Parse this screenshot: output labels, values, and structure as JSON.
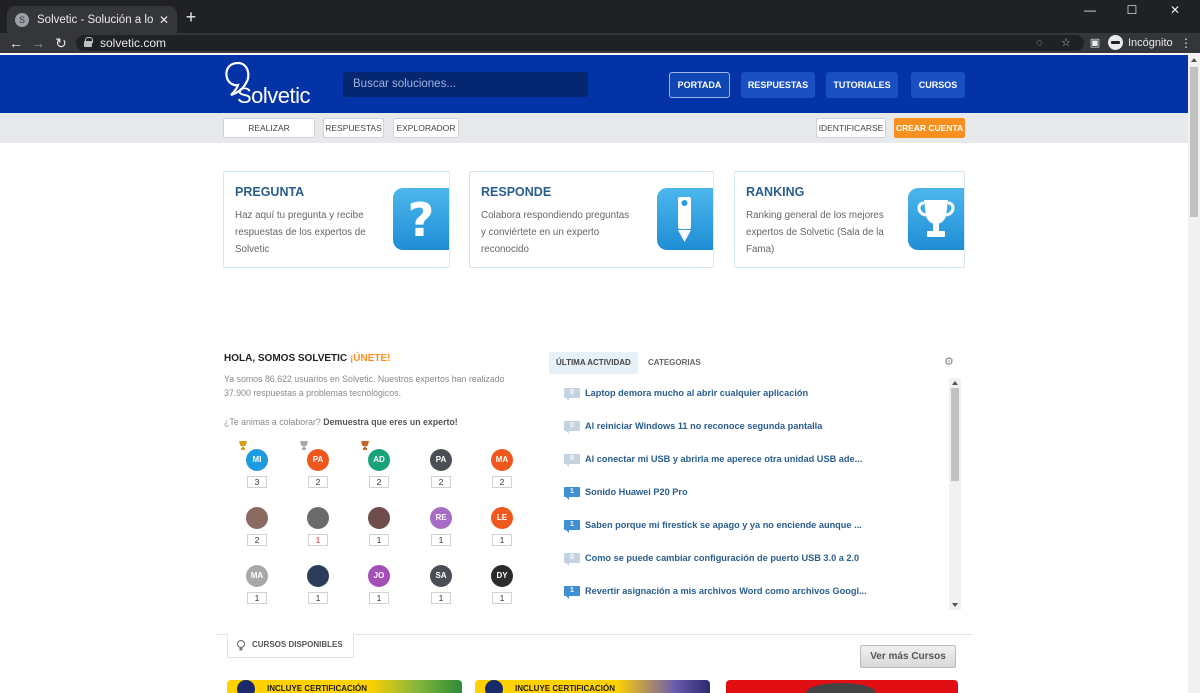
{
  "browser": {
    "tab_title": "Solvetic - Solución a los problem",
    "url": "solvetic.com",
    "profile": "Incógnito",
    "newtab_glyph": "+",
    "close_glyph": "✕",
    "min_glyph": "—",
    "max_glyph": "☐",
    "winclose_glyph": "✕",
    "back_glyph": "←",
    "forward_glyph": "→",
    "reload_glyph": "↻",
    "menu_glyph": "⋮"
  },
  "site": {
    "logo_text": "Solvetic",
    "search_placeholder": "Buscar soluciones...",
    "nav": [
      "PORTADA",
      "RESPUESTAS",
      "TUTORIALES",
      "CURSOS"
    ],
    "subnav": [
      "REALIZAR PREGUNTA",
      "RESPUESTAS",
      "EXPLORADOR"
    ],
    "login_label": "IDENTIFICARSE",
    "signup_label": "CREAR CUENTA"
  },
  "cards": [
    {
      "title": "PREGUNTA",
      "desc": "Haz aquí tu pregunta y recibe respuestas de los expertos de Solvetic",
      "icon": "question-icon"
    },
    {
      "title": "RESPONDE",
      "desc": "Colabora respondiendo preguntas y conviértete en un experto reconocido",
      "icon": "pencil-icon"
    },
    {
      "title": "RANKING",
      "desc": "Ranking general de los mejores expertos de Solvetic (Sala de la Fama)",
      "icon": "trophy-icon"
    }
  ],
  "hola": {
    "title": "HOLA, SOMOS SOLVETIC",
    "join": "¡ÚNETE!",
    "text": "Ya somos 86.622 usuarios en Solvetic. Nuestros expertos han realizado 37.900 respuestas a problemas tecnológicos.",
    "animas": "¿Te animas a colaborar?",
    "animas_bold": "Demuestra que eres un experto!"
  },
  "users": [
    {
      "initials": "MI",
      "count": "3",
      "color": "#1e9be0",
      "trophy": "#d4a017"
    },
    {
      "initials": "PA",
      "count": "2",
      "color": "#f0571d",
      "trophy": "#a8a8a8"
    },
    {
      "initials": "AD",
      "count": "2",
      "color": "#1aa37a",
      "trophy": "#c8622a"
    },
    {
      "initials": "PA",
      "count": "2",
      "color": "#4a4f55",
      "trophy": ""
    },
    {
      "initials": "MA",
      "count": "2",
      "color": "#f0571d",
      "trophy": ""
    },
    {
      "initials": "",
      "count": "2",
      "color": "#8a6a60",
      "trophy": ""
    },
    {
      "initials": "",
      "count": "1",
      "color": "#6b6b6b",
      "trophy": "",
      "red": true
    },
    {
      "initials": "",
      "count": "1",
      "color": "#6e4d4a",
      "trophy": ""
    },
    {
      "initials": "RE",
      "count": "1",
      "color": "#a76cc6",
      "trophy": ""
    },
    {
      "initials": "LE",
      "count": "1",
      "color": "#f0571d",
      "trophy": ""
    },
    {
      "initials": "MA",
      "count": "1",
      "color": "#a8a8a8",
      "trophy": ""
    },
    {
      "initials": "",
      "count": "1",
      "color": "#2a3d5a",
      "trophy": ""
    },
    {
      "initials": "JO",
      "count": "1",
      "color": "#a44fb8",
      "trophy": ""
    },
    {
      "initials": "SA",
      "count": "1",
      "color": "#4a4f55",
      "trophy": ""
    },
    {
      "initials": "DY",
      "count": "1",
      "color": "#2b2b2b",
      "trophy": ""
    }
  ],
  "activity": {
    "tabs": [
      "ÚLTIMA ACTIVIDAD",
      "CATEGORIAS"
    ],
    "items": [
      {
        "count": "0",
        "text": "Laptop demora mucho al abrir cualquier aplicación"
      },
      {
        "count": "0",
        "text": "Al reiniciar Windows 11 no reconoce segunda pantalla"
      },
      {
        "count": "0",
        "text": "Al conectar mi USB y abrirla me aperece otra unidad USB ade..."
      },
      {
        "count": "1",
        "text": "Sonido Huawei P20 Pro"
      },
      {
        "count": "1",
        "text": "Saben porque mi firestick se apago y ya no enciende aunque ..."
      },
      {
        "count": "0",
        "text": "Como se puede cambiar configuración de puerto USB 3.0 a 2.0"
      },
      {
        "count": "1",
        "text": "Revertir asignación a mis archivos Word como archivos Googl..."
      }
    ]
  },
  "courses": {
    "tab_label": "CURSOS DISPONIBLES",
    "more_label": "Ver más Cursos",
    "banner_label": "INCLUYE CERTIFICACIÓN"
  }
}
